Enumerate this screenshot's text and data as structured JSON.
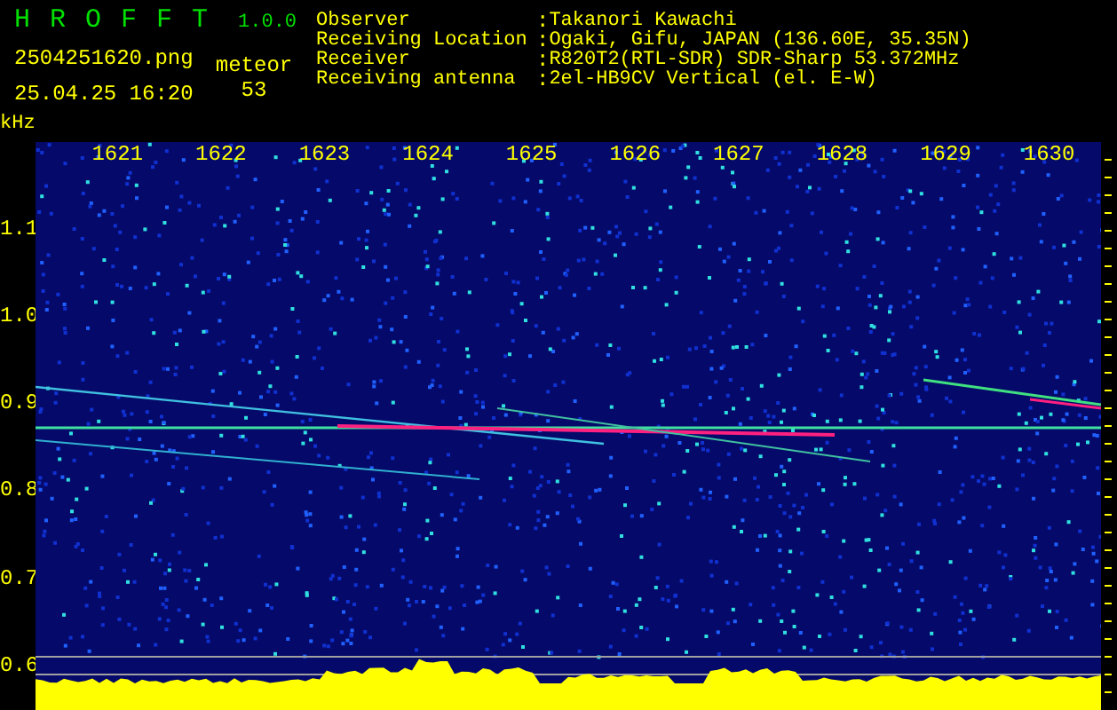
{
  "app": {
    "name": "H R O F F T",
    "version": "1.0.0"
  },
  "file_name": "2504251620.png",
  "timestamp": "25.04.25 16:20",
  "meteor": {
    "label": "meteor",
    "count": "53"
  },
  "station": [
    {
      "label": "Observer",
      "separator": ":",
      "value": "Takanori Kawachi"
    },
    {
      "label": "Receiving Location",
      "separator": ":",
      "value": "Ogaki, Gifu, JAPAN (136.60E, 35.35N)"
    },
    {
      "label": "Receiver",
      "separator": ":",
      "value": "R820T2(RTL-SDR) SDR-Sharp 53.372MHz"
    },
    {
      "label": "Receiving antenna",
      "separator": ":",
      "value": "2el-HB9CV Vertical (el. E-W)"
    }
  ],
  "y_axis": {
    "unit": "kHz",
    "labels": [
      "1.1",
      "1.0",
      "0.9",
      "0.8",
      "0.7",
      "0.6"
    ]
  },
  "x_axis": {
    "labels": [
      "1621",
      "1622",
      "1623",
      "1624",
      "1625",
      "1626",
      "1627",
      "1628",
      "1629",
      "1630"
    ]
  }
}
